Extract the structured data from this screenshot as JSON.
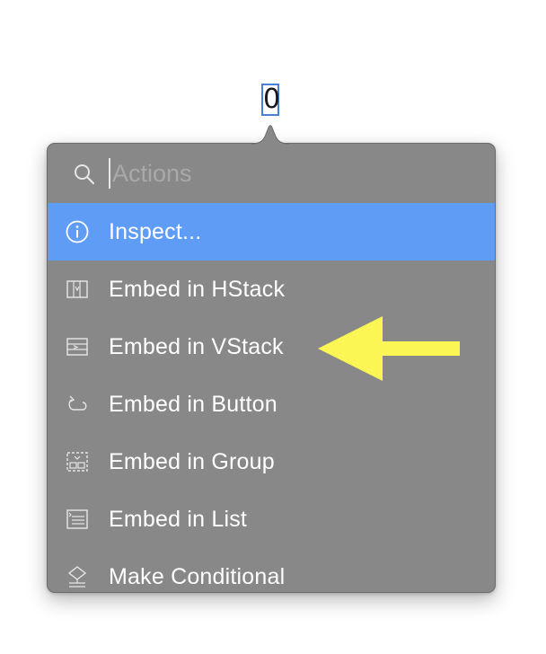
{
  "selected_element": {
    "text": "0"
  },
  "popover": {
    "search": {
      "placeholder": "Actions",
      "value": "",
      "icon": "search-icon"
    },
    "items": [
      {
        "label": "Inspect...",
        "icon": "info-circle-icon",
        "highlighted": true
      },
      {
        "label": "Embed in HStack",
        "icon": "hstack-icon",
        "highlighted": false
      },
      {
        "label": "Embed in VStack",
        "icon": "vstack-icon",
        "highlighted": false
      },
      {
        "label": "Embed in Button",
        "icon": "button-embed-icon",
        "highlighted": false
      },
      {
        "label": "Embed in Group",
        "icon": "group-icon",
        "highlighted": false
      },
      {
        "label": "Embed in List",
        "icon": "list-icon",
        "highlighted": false
      },
      {
        "label": "Make Conditional",
        "icon": "conditional-icon",
        "highlighted": false
      }
    ]
  },
  "colors": {
    "popover_background": "#888888",
    "highlight": "#5f9cf6",
    "text": "#ffffff",
    "placeholder": "#a9a9a9",
    "selection_border": "#4a7fd8",
    "annotation_arrow": "#fbf653"
  }
}
